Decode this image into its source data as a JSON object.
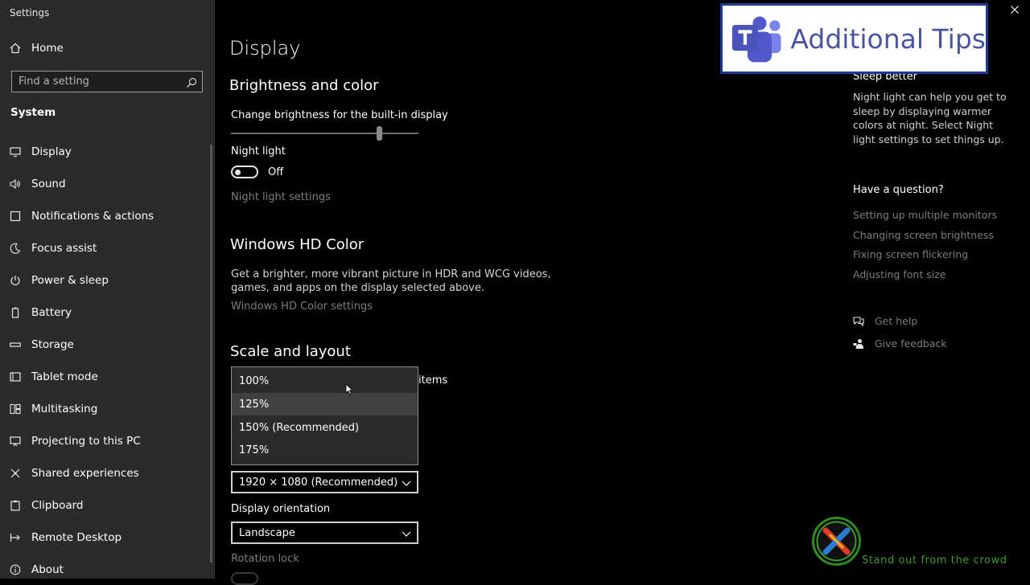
{
  "app_title": "Settings",
  "sidebar": {
    "home": "Home",
    "search_placeholder": "Find a setting",
    "section": "System",
    "items": [
      {
        "label": "Display",
        "icon": "monitor-icon"
      },
      {
        "label": "Sound",
        "icon": "speaker-icon"
      },
      {
        "label": "Notifications & actions",
        "icon": "notification-icon"
      },
      {
        "label": "Focus assist",
        "icon": "moon-icon"
      },
      {
        "label": "Power & sleep",
        "icon": "power-icon"
      },
      {
        "label": "Battery",
        "icon": "battery-icon"
      },
      {
        "label": "Storage",
        "icon": "storage-icon"
      },
      {
        "label": "Tablet mode",
        "icon": "tablet-icon"
      },
      {
        "label": "Multitasking",
        "icon": "multitasking-icon"
      },
      {
        "label": "Projecting to this PC",
        "icon": "projecting-icon"
      },
      {
        "label": "Shared experiences",
        "icon": "shared-icon"
      },
      {
        "label": "Clipboard",
        "icon": "clipboard-icon"
      },
      {
        "label": "Remote Desktop",
        "icon": "remote-desktop-icon"
      },
      {
        "label": "About",
        "icon": "info-icon"
      }
    ]
  },
  "main": {
    "title": "Display",
    "brightness": {
      "heading": "Brightness and color",
      "label": "Change brightness for the built-in display",
      "level": 0.79
    },
    "night_light": {
      "label": "Night light",
      "state": "Off",
      "settings_link": "Night light settings"
    },
    "hd_color": {
      "heading": "Windows HD Color",
      "description_1": "Get a brighter, more vibrant picture in HDR and WCG videos,",
      "description_2": "games, and apps on the display selected above.",
      "settings_link": "Windows HD Color settings"
    },
    "scale": {
      "heading": "Scale and layout",
      "partial_label": "items",
      "options": [
        "100%",
        "125%",
        "150% (Recommended)",
        "175%"
      ],
      "hovered": "125%"
    },
    "resolution": {
      "value": "1920 × 1080 (Recommended)"
    },
    "orientation": {
      "label": "Display orientation",
      "value": "Landscape"
    },
    "rotation_lock": {
      "label": "Rotation lock"
    }
  },
  "right_panel": {
    "sleep_heading": "Sleep better",
    "sleep_text": "Night light can help you get to sleep by displaying warmer colors at night. Select Night light settings to set things up.",
    "question_heading": "Have a question?",
    "links": [
      "Setting up multiple monitors",
      "Changing screen brightness",
      "Fixing screen flickering",
      "Adjusting font size"
    ],
    "get_help": "Get help",
    "give_feedback": "Give feedback"
  },
  "overlay": {
    "banner_text": "Additional Tips",
    "watermark_text": "Stand out from the crowd"
  },
  "colors": {
    "sidebar_bg": "#2b2b2b",
    "main_bg": "#000000",
    "banner_text": "#4a55a2",
    "watermark": "#3a9a2a"
  }
}
